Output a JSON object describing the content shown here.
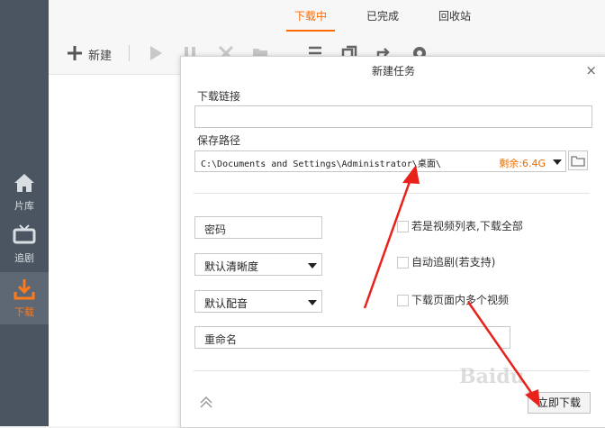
{
  "sidebar": {
    "items": [
      {
        "label": "片库",
        "icon": "home-icon"
      },
      {
        "label": "追剧",
        "icon": "tv-icon"
      },
      {
        "label": "下载",
        "icon": "download-icon"
      }
    ]
  },
  "tabs": [
    {
      "label": "下载中",
      "active": true
    },
    {
      "label": "已完成",
      "active": false
    },
    {
      "label": "回收站",
      "active": false
    }
  ],
  "toolbar": {
    "new_label": "新建",
    "icons": [
      "plus-icon",
      "play-icon",
      "pause-icon",
      "delete-icon",
      "folder-icon",
      "list-icon",
      "copy-icon",
      "share-icon",
      "settings-icon"
    ]
  },
  "dialog": {
    "title": "新建任务",
    "close_label": "×",
    "link_label": "下载链接",
    "link_value": "",
    "path_label": "保存路径",
    "path_value": "C:\\Documents  and  Settings\\Administrator\\桌面\\",
    "remaining": "剩余:6.4G",
    "password_placeholder": "密码",
    "quality_value": "默认清晰度",
    "audio_value": "默认配音",
    "rename_placeholder": "重命名",
    "options": [
      {
        "label": "若是视频列表,下载全部",
        "checked": false
      },
      {
        "label": "自动追剧(若支持)",
        "checked": false
      },
      {
        "label": "下载页面内多个视频",
        "checked": false
      }
    ],
    "download_button": "立即下载"
  },
  "watermark": "Baidu",
  "colors": {
    "accent": "#ff6a00",
    "sidebar_bg": "#4a5561",
    "arrow": "#e8221b"
  }
}
